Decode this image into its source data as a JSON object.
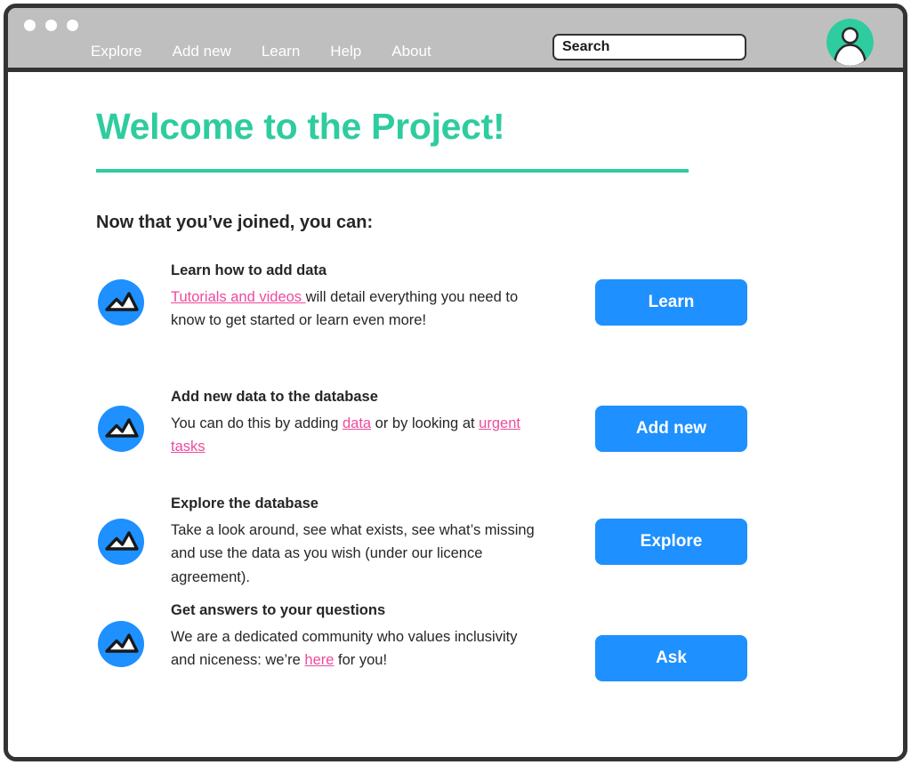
{
  "window": {
    "traffic_lights": [
      "close",
      "minimize",
      "maximize"
    ],
    "chrome_color": "#bfbfbf",
    "border_color": "#333333"
  },
  "nav": {
    "items": [
      {
        "label": "Explore"
      },
      {
        "label": "Add new"
      },
      {
        "label": "Learn"
      },
      {
        "label": "Help"
      },
      {
        "label": "About"
      }
    ],
    "search": {
      "value": "",
      "placeholder": "Search",
      "icon": "search-icon"
    },
    "avatar": {
      "icon": "user-avatar-icon",
      "background": "#2ecc9f"
    }
  },
  "main": {
    "title": "Welcome to the Project!",
    "title_color": "#2ecc9f",
    "rule_color": "#2ecc9f",
    "subtitle": "Now that you’ve joined, you can:",
    "link_color": "#ef4a9c",
    "button_color": "#1e90ff",
    "features": [
      {
        "icon": "mountain-image-icon",
        "title": "Learn how to add data",
        "description": [
          {
            "text": "Tutorials and videos ",
            "link": true
          },
          {
            "text": "will detail everything you need to know to get started or learn even more!",
            "link": false
          }
        ],
        "button_label": "Learn"
      },
      {
        "icon": "mountain-image-icon",
        "title": "Add new data to the database",
        "description": [
          {
            "text": "You can do this by adding ",
            "link": false
          },
          {
            "text": "data",
            "link": true
          },
          {
            "text": " or by looking at ",
            "link": false
          },
          {
            "text": "urgent tasks",
            "link": true
          }
        ],
        "button_label": "Add new"
      },
      {
        "icon": "mountain-image-icon",
        "title": "Explore the database",
        "description": [
          {
            "text": "Take a look around, see what exists, see what’s missing and use the data as you wish (under our licence agreement).",
            "link": false
          }
        ],
        "button_label": "Explore"
      },
      {
        "icon": "mountain-image-icon",
        "title": "Get answers to your questions",
        "description": [
          {
            "text": "We are a dedicated community who values inclusivity and niceness: we’re ",
            "link": false
          },
          {
            "text": "here",
            "link": true
          },
          {
            "text": " for you!",
            "link": false
          }
        ],
        "button_label": "Ask"
      }
    ]
  }
}
